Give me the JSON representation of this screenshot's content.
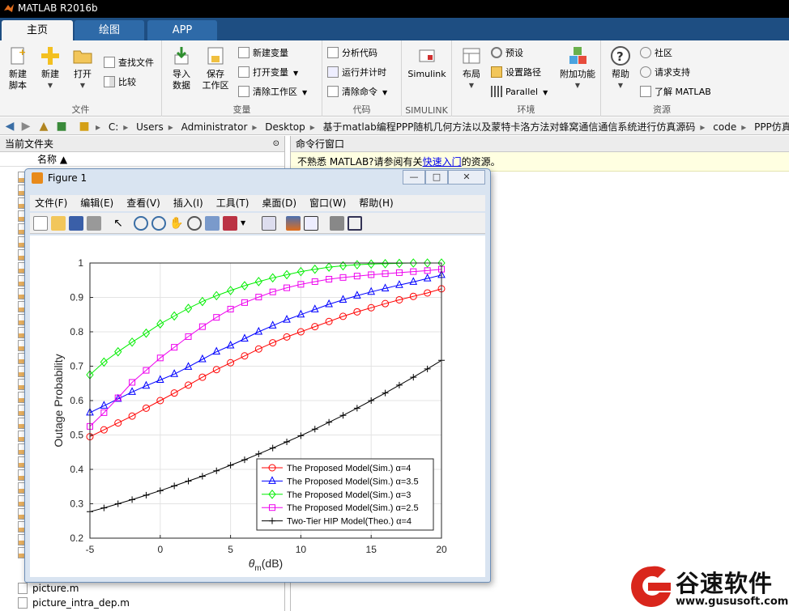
{
  "window": {
    "title": "MATLAB R2016b"
  },
  "tabs": [
    {
      "label": "主页",
      "active": true
    },
    {
      "label": "绘图",
      "active": false
    },
    {
      "label": "APP",
      "active": false
    }
  ],
  "ribbon": {
    "file": {
      "label": "文件",
      "new_script": "新建\n脚本",
      "new": "新建",
      "open": "打开",
      "find_files": "查找文件",
      "compare": "比较"
    },
    "variable": {
      "label": "变量",
      "import_data": "导入\n数据",
      "save_workspace": "保存\n工作区",
      "new_variable": "新建变量",
      "open_variable": "打开变量",
      "clear_workspace": "清除工作区"
    },
    "code": {
      "label": "代码",
      "analyze_code": "分析代码",
      "run_and_time": "运行并计时",
      "clear_commands": "清除命令"
    },
    "simulink": {
      "label": "SIMULINK",
      "simulink": "Simulink"
    },
    "environment": {
      "label": "环境",
      "layout": "布局",
      "preferences": "预设",
      "set_path": "设置路径",
      "parallel": "Parallel",
      "add_ons": "附加功能"
    },
    "resources": {
      "label": "资源",
      "help": "帮助",
      "community": "社区",
      "request_support": "请求支持",
      "learn_matlab": "了解 MATLAB"
    }
  },
  "address_bar": {
    "crumbs": [
      "C:",
      "Users",
      "Administrator",
      "Desktop",
      "基于matlab编程PPP随机几何方法以及蒙特卡洛方法对蜂窝通信通信系统进行仿真源码",
      "code",
      "PPP仿真"
    ]
  },
  "current_folder": {
    "title": "当前文件夹",
    "column_name": "名称 ▲",
    "files": [
      "picture.m",
      "picture_intra_dep.m"
    ]
  },
  "command_window": {
    "title": "命令行窗口",
    "hint_before": "不熟悉 MATLAB?请参阅有关",
    "hint_link": "快速入门",
    "hint_after": "的资源。"
  },
  "figure": {
    "title": "Figure 1",
    "menu": [
      "文件(F)",
      "编辑(E)",
      "查看(V)",
      "插入(I)",
      "工具(T)",
      "桌面(D)",
      "窗口(W)",
      "帮助(H)"
    ]
  },
  "chart_data": {
    "type": "line",
    "title": "",
    "xlabel": "θm(dB)",
    "ylabel": "Outage Probability",
    "xlim": [
      -5,
      20
    ],
    "ylim": [
      0.2,
      1
    ],
    "xticks": [
      -5,
      0,
      5,
      10,
      15,
      20
    ],
    "yticks": [
      0.2,
      0.3,
      0.4,
      0.5,
      0.6,
      0.7,
      0.8,
      0.9,
      1
    ],
    "grid": true,
    "legend_position": "bottom-right",
    "x": [
      -5,
      -4,
      -3,
      -2,
      -1,
      0,
      1,
      2,
      3,
      4,
      5,
      6,
      7,
      8,
      9,
      10,
      11,
      12,
      13,
      14,
      15,
      16,
      17,
      18,
      19,
      20
    ],
    "series": [
      {
        "name": "The Proposed Model(Sim.) α=4",
        "color": "#ff0000",
        "marker": "circle",
        "values": [
          0.495,
          0.515,
          0.535,
          0.555,
          0.578,
          0.6,
          0.622,
          0.645,
          0.668,
          0.69,
          0.71,
          0.73,
          0.75,
          0.768,
          0.785,
          0.8,
          0.815,
          0.83,
          0.845,
          0.858,
          0.87,
          0.882,
          0.893,
          0.903,
          0.913,
          0.925
        ]
      },
      {
        "name": "The Proposed Model(Sim.) α=3.5",
        "color": "#0000ff",
        "marker": "triangle",
        "values": [
          0.565,
          0.585,
          0.605,
          0.625,
          0.643,
          0.66,
          0.677,
          0.698,
          0.72,
          0.742,
          0.76,
          0.78,
          0.8,
          0.818,
          0.835,
          0.85,
          0.865,
          0.88,
          0.893,
          0.905,
          0.916,
          0.926,
          0.936,
          0.945,
          0.955,
          0.965
        ]
      },
      {
        "name": "The Proposed Model(Sim.) α=3",
        "color": "#00ee00",
        "marker": "diamond",
        "values": [
          0.675,
          0.712,
          0.742,
          0.77,
          0.796,
          0.823,
          0.846,
          0.868,
          0.888,
          0.905,
          0.92,
          0.934,
          0.946,
          0.957,
          0.966,
          0.975,
          0.982,
          0.988,
          0.992,
          0.995,
          0.997,
          0.998,
          0.999,
          1.0,
          1.0,
          1.0
        ]
      },
      {
        "name": "The Proposed Model(Sim.) α=2.5",
        "color": "#ee00ee",
        "marker": "square",
        "values": [
          0.525,
          0.565,
          0.608,
          0.653,
          0.688,
          0.724,
          0.755,
          0.786,
          0.815,
          0.842,
          0.866,
          0.885,
          0.901,
          0.916,
          0.928,
          0.938,
          0.946,
          0.953,
          0.958,
          0.962,
          0.966,
          0.969,
          0.972,
          0.975,
          0.978,
          0.982
        ]
      },
      {
        "name": "Two-Tier HIP Model(Theo.) α=4",
        "color": "#000000",
        "marker": "plus",
        "values": [
          0.277,
          0.288,
          0.3,
          0.312,
          0.325,
          0.338,
          0.352,
          0.366,
          0.38,
          0.396,
          0.412,
          0.428,
          0.445,
          0.462,
          0.48,
          0.498,
          0.517,
          0.537,
          0.557,
          0.578,
          0.6,
          0.622,
          0.645,
          0.668,
          0.692,
          0.717
        ]
      }
    ]
  },
  "watermark": {
    "text": "谷速软件",
    "url": "www.gususoft.com"
  }
}
